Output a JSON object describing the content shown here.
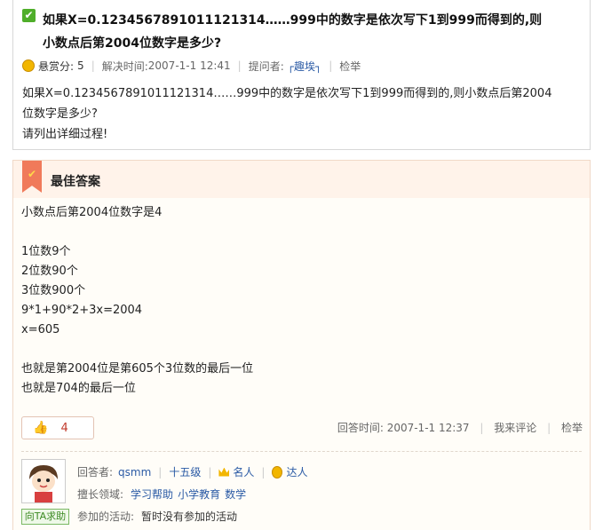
{
  "question": {
    "title_line1": "如果X=0.1234567891011121314……999中的数字是依次写下1到999而得到的,则",
    "title_line2": "小数点后第2004位数字是多少?",
    "reward_label": "悬赏分:",
    "reward_value": "5",
    "resolved_label": "解决时间:",
    "resolved_time": "2007-1-1 12:41",
    "asker_label": "提问者:",
    "asker_name": "┌趣埃┐",
    "report_label": "检举",
    "body_line1": "如果X=0.1234567891011121314……999中的数字是依次写下1到999而得到的,则小数点后第2004",
    "body_line2": "位数字是多少?",
    "body_line3": "请列出详细过程!"
  },
  "answer": {
    "header": "最佳答案",
    "lines": [
      "小数点后第2004位数字是4",
      "",
      "1位数9个",
      "2位数90个",
      "3位数900个",
      "9*1+90*2+3x=2004",
      "x=605",
      "",
      "也就是第2004位是第605个3位数的最后一位",
      "也就是704的最后一位"
    ],
    "like_count": "4",
    "answer_time_label": "回答时间:",
    "answer_time": "2007-1-1 12:37",
    "comment_label": "我来评论",
    "report_label": "检举"
  },
  "answerer": {
    "label": "回答者:",
    "name": "qsmm",
    "level": "十五级",
    "badge1": "名人",
    "badge2": "达人",
    "field_label": "擅长领域:",
    "fields": [
      "学习帮助",
      "小学教育",
      "数学"
    ],
    "activity_label": "参加的活动:",
    "activity_value": "暂时没有参加的活动",
    "help_button": "向TA求助"
  }
}
